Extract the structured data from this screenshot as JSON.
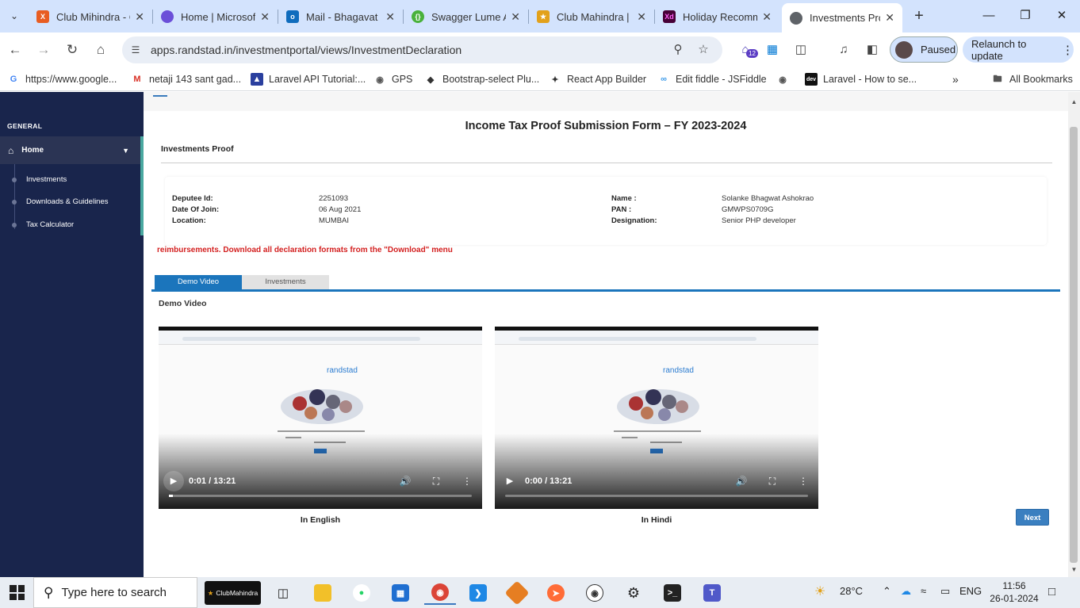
{
  "browser": {
    "tabs": [
      {
        "label": "Club Mihindra - C",
        "favicon_color": "#e85d22"
      },
      {
        "label": "Home | Microsoft",
        "favicon_color": "#6b4fd8"
      },
      {
        "label": "Mail - Bhagavat",
        "favicon_color": "#0f6cbd"
      },
      {
        "label": "Swagger Lume A",
        "favicon_color": "#49b13b"
      },
      {
        "label": "Club Mahindra |",
        "favicon_color": "#e2a11b"
      },
      {
        "label": "Holiday Recomm",
        "favicon_color": "#470137"
      },
      {
        "label": "Investments Pro",
        "favicon_color": "#5f6368"
      }
    ],
    "url": "apps.randstad.in/investmentportal/views/InvestmentDeclaration",
    "profile_status": "Paused",
    "relaunch_label": "Relaunch to update",
    "extension_badge": "12",
    "bookmarks": [
      {
        "label": "https://www.google...",
        "icon": "google-icon"
      },
      {
        "label": "netaji 143 sant gad...",
        "icon": "gmail-icon"
      },
      {
        "label": "Laravel API Tutorial:...",
        "icon": "bookmark-icon"
      },
      {
        "label": "GPS",
        "icon": "globe-icon"
      },
      {
        "label": "Bootstrap-select Plu...",
        "icon": "bootstrap-icon"
      },
      {
        "label": "React App Builder",
        "icon": "react-icon"
      },
      {
        "label": "Edit fiddle - JSFiddle",
        "icon": "jsfiddle-icon"
      },
      {
        "label": "Laravel - How to se...",
        "icon": "dev-icon"
      }
    ],
    "all_bookmarks_label": "All Bookmarks"
  },
  "sidebar": {
    "section_label": "GENERAL",
    "home_label": "Home",
    "items": [
      {
        "label": "Investments"
      },
      {
        "label": "Downloads & Guidelines"
      },
      {
        "label": "Tax Calculator"
      }
    ]
  },
  "form": {
    "title": "Income Tax Proof Submission Form – FY 2023-2024",
    "section_title": "Investments Proof",
    "employee": {
      "deputee_id_label": "Deputee Id:",
      "deputee_id": "2251093",
      "date_of_join_label": "Date Of Join:",
      "date_of_join": "06 Aug 2021",
      "location_label": "Location:",
      "location": "MUMBAI",
      "name_label": "Name :",
      "name": "Solanke Bhagwat Ashokrao",
      "pan_label": "PAN :",
      "pan": "GMWPS0709G",
      "designation_label": "Designation:",
      "designation": "Senior PHP developer"
    },
    "notice": "reimbursements. Download all declaration formats from the \"Download\" menu",
    "tabs": [
      {
        "label": "Demo Video",
        "active": true
      },
      {
        "label": "Investments",
        "active": false
      }
    ],
    "panel_title": "Demo Video",
    "videos": [
      {
        "time": "0:01 / 13:21",
        "caption": "In English",
        "logo_text": "randstad",
        "progress": 0.01
      },
      {
        "time": "0:00 / 13:21",
        "caption": "In Hindi",
        "logo_text": "randstad",
        "progress": 0.0
      }
    ],
    "next_label": "Next"
  },
  "taskbar": {
    "search_placeholder": "Type here to search",
    "pinned_app_label": "ClubMahindra",
    "weather": "28°C",
    "language": "ENG",
    "time": "11:56",
    "date": "26-01-2024"
  },
  "colors": {
    "sidebar_bg": "#19254c",
    "sidebar_accent": "#4aa8a0",
    "tab_active": "#1b75bc",
    "notice_red": "#d31f1f",
    "next_button": "#3a7fc0"
  }
}
